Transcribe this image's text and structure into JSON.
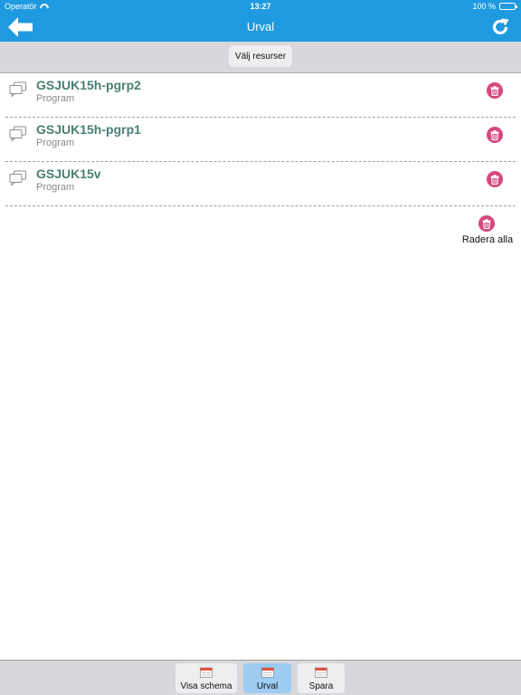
{
  "status": {
    "carrier": "Operatör",
    "time": "13:27",
    "battery": "100 %"
  },
  "nav": {
    "title": "Urval",
    "back_icon": "back-arrow-icon",
    "refresh_icon": "refresh-icon"
  },
  "toolbar": {
    "choose_label": "Välj resurser"
  },
  "items": [
    {
      "name": "GSJUK15h-pgrp2",
      "type": "Program"
    },
    {
      "name": "GSJUK15h-pgrp1",
      "type": "Program"
    },
    {
      "name": "GSJUK15v",
      "type": "Program"
    }
  ],
  "delete_all_label": "Radera alla",
  "tabs": [
    {
      "label": "Visa schema",
      "active": false
    },
    {
      "label": "Urval",
      "active": true
    },
    {
      "label": "Spara",
      "active": false
    }
  ],
  "colors": {
    "accent": "#1f9ae0",
    "item_name": "#4a7f73",
    "delete": "#d5497e",
    "tab_active": "#9dcbf2"
  }
}
